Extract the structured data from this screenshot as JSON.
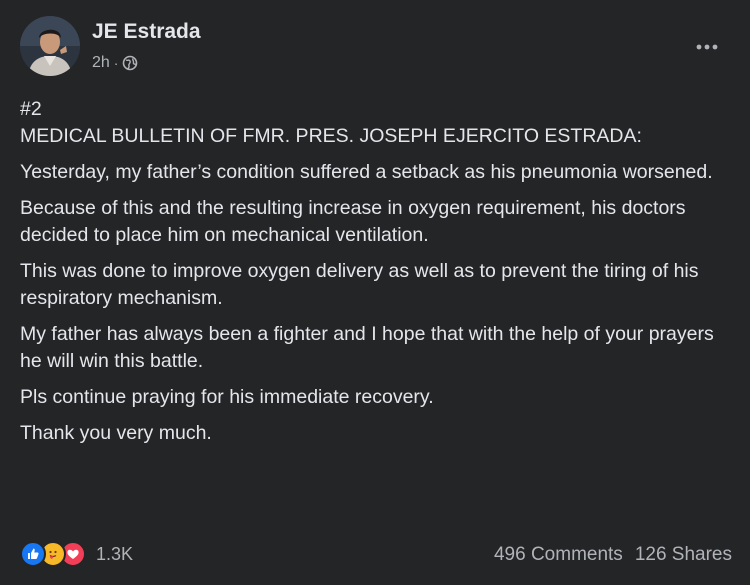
{
  "post": {
    "author": "JE Estrada",
    "time": "2h",
    "separator": "·",
    "icons": {
      "privacy": "globe-icon",
      "more": "more-horizontal-icon",
      "reactions": [
        "like-icon",
        "care-icon",
        "love-icon"
      ]
    },
    "colors": {
      "background": "#242526",
      "text": "#e4e6eb",
      "secondary_text": "#b0b3b8",
      "like": "#1877f2",
      "care": "#f7b928",
      "love": "#f33e58"
    },
    "paragraphs": [
      "#2",
      "MEDICAL BULLETIN OF FMR. PRES. JOSEPH EJERCITO ESTRADA:",
      "Yesterday, my father’s condition suffered a setback as his pneumonia worsened.",
      "Because of this and the resulting increase in oxygen requirement, his doctors decided to place him on mechanical ventilation.",
      "This was done to improve oxygen delivery as well as to prevent the tiring of his respiratory mechanism.",
      "My father has always been a fighter and I hope that with the help of your prayers he will win this battle.",
      "Pls continue praying for his immediate recovery.",
      "Thank you very much."
    ],
    "reaction_count": "1.3K",
    "comments": "496 Comments",
    "shares": "126 Shares"
  }
}
